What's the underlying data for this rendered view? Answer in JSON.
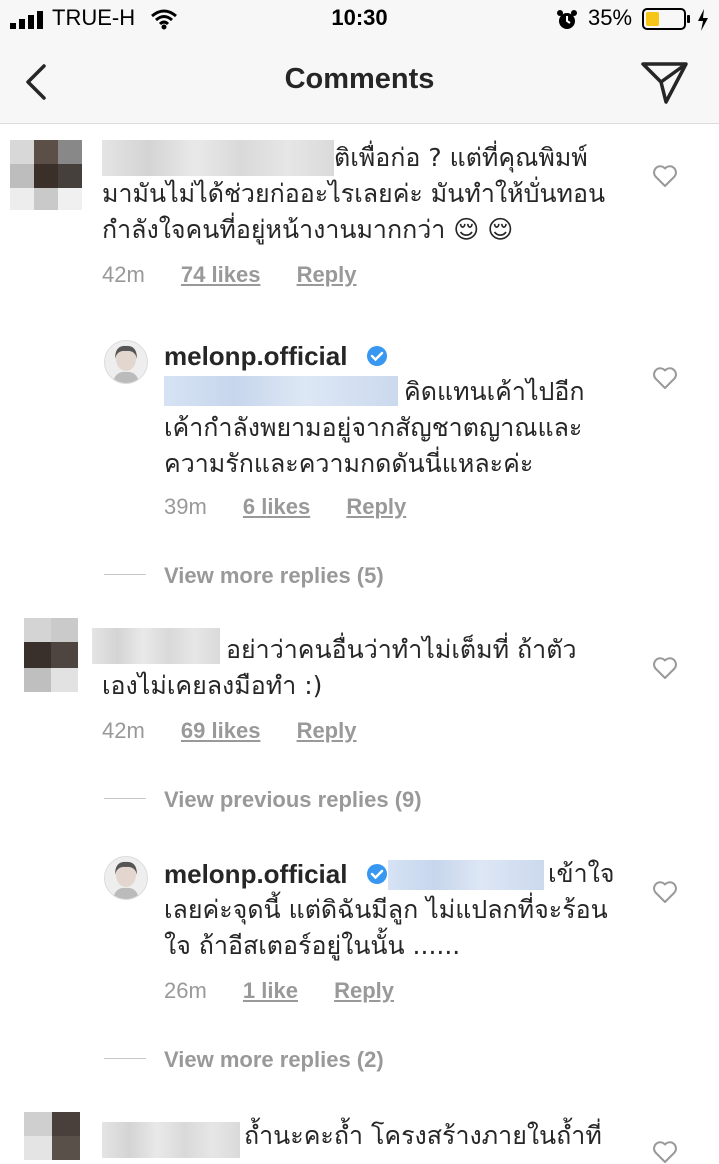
{
  "status_bar": {
    "carrier": "TRUE-H",
    "time": "10:30",
    "battery_percent": "35%",
    "battery_level": 0.35
  },
  "header": {
    "title": "Comments",
    "back_icon": "chevron-left-icon",
    "share_icon": "paper-plane-icon"
  },
  "comments": [
    {
      "username_hidden": true,
      "lines": [
        "ติเพื่อก่อ ? แต่ที่คุณพิมพ์",
        "มามันไม่ได้ช่วยก่ออะไรเลยค่ะ มันทำให้บั่นทอน",
        "กำลังใจคนที่อยู่หน้างานมากกว่า 😌 😌"
      ],
      "time": "42m",
      "likes": "74 likes",
      "reply": "Reply"
    },
    {
      "username": "melonp.official",
      "verified": true,
      "lines": [
        "คิดแทนเค้าไปอีก",
        "เค้ากำลังพยามอยู่จากสัญชาตญาณและ",
        "ความรักและความกดดันนี่แหละค่ะ"
      ],
      "time": "39m",
      "likes": "6 likes",
      "reply": "Reply"
    },
    {
      "username_hidden": true,
      "lines": [
        "อย่าว่าคนอื่นว่าทำไม่เต็มที่ ถ้าตัว",
        "เองไม่เคยลงมือทำ :)"
      ],
      "time": "42m",
      "likes": "69 likes",
      "reply": "Reply"
    },
    {
      "username": "melonp.official",
      "verified": true,
      "lines": [
        "เข้าใจ",
        "เลยค่ะจุดนี้ แต่ดิฉันมีลูก ไม่แปลกที่จะร้อน",
        "ใจ ถ้าอีสเตอร์อยู่ในนั้น ......"
      ],
      "time": "26m",
      "likes": "1 like",
      "reply": "Reply"
    },
    {
      "username_hidden": true,
      "lines": [
        "ถ้ำนะคะถ้ำ โครงสร้างภายในถ้ำที่"
      ]
    }
  ],
  "view_replies": {
    "first": "View more replies (5)",
    "previous": "View previous replies (9)",
    "second": "View more replies (2)"
  },
  "colors": {
    "text": "#262626",
    "muted": "#999999",
    "verified": "#3897f0",
    "battery": "#f5c518"
  }
}
